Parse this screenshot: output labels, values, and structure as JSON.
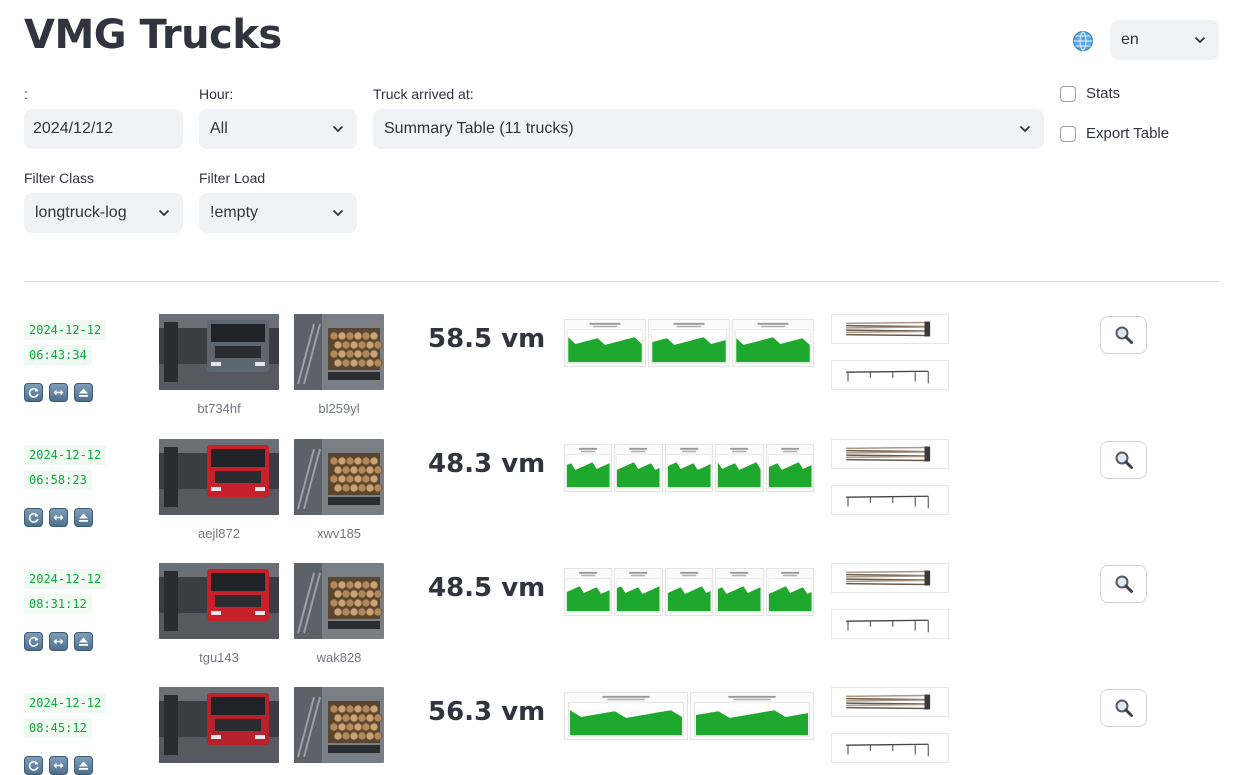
{
  "app": {
    "title": "VMG Trucks"
  },
  "language": {
    "selected": "en"
  },
  "filters": {
    "date": {
      "label": ":",
      "value": "2024/12/12"
    },
    "hour": {
      "label": "Hour:",
      "value": "All"
    },
    "truck_arrived": {
      "label": "Truck arrived at:",
      "value": "Summary Table (11 trucks)"
    },
    "filter_class": {
      "label": "Filter Class",
      "value": "longtruck-log"
    },
    "filter_load": {
      "label": "Filter Load",
      "value": "!empty"
    }
  },
  "options": {
    "stats": {
      "label": "Stats",
      "checked": false
    },
    "export_table": {
      "label": "Export Table",
      "checked": false
    }
  },
  "trucks": [
    {
      "date": "2024-12-12",
      "time": "06:43:34",
      "front_plate": "bt734hf",
      "back_plate": "bl259yl",
      "volume": "58.5 vm",
      "chart_count": 3,
      "cab_color": "#5e6670"
    },
    {
      "date": "2024-12-12",
      "time": "06:58:23",
      "front_plate": "aejl872",
      "back_plate": "xwv185",
      "volume": "48.3 vm",
      "chart_count": 5,
      "cab_color": "#c8202a"
    },
    {
      "date": "2024-12-12",
      "time": "08:31:12",
      "front_plate": "tgu143",
      "back_plate": "wak828",
      "volume": "48.5 vm",
      "chart_count": 5,
      "cab_color": "#c8202a"
    },
    {
      "date": "2024-12-12",
      "time": "08:45:12",
      "front_plate": "",
      "back_plate": "",
      "volume": "56.3 vm",
      "chart_count": 2,
      "cab_color": "#b8222c"
    }
  ],
  "colors": {
    "accent": "#09ab3b",
    "chart_fill": "#1ea82d",
    "text": "#31333f"
  },
  "icons": {
    "globe": "globe-icon",
    "chevron": "chevron-down-icon",
    "zoom": "magnifier-icon",
    "refresh": "refresh-icon",
    "swap": "swap-icon",
    "eject": "eject-icon"
  }
}
